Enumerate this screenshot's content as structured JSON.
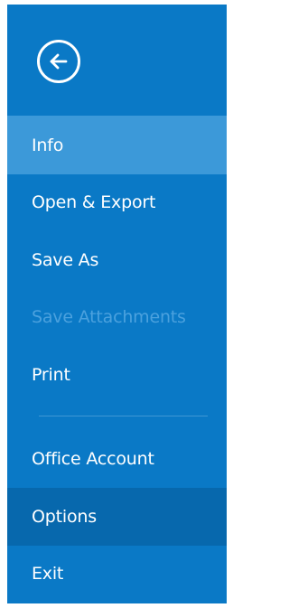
{
  "backstage": {
    "back_icon": "back-arrow-circle-icon",
    "items": [
      {
        "label": "Info",
        "state": "selected"
      },
      {
        "label": "Open & Export",
        "state": "normal"
      },
      {
        "label": "Save As",
        "state": "normal"
      },
      {
        "label": "Save Attachments",
        "state": "disabled"
      },
      {
        "label": "Print",
        "state": "normal"
      },
      {
        "label": "Office Account",
        "state": "normal"
      },
      {
        "label": "Options",
        "state": "hovered"
      },
      {
        "label": "Exit",
        "state": "normal"
      }
    ],
    "colors": {
      "background": "#0a79c6",
      "selected": "#3c99d9",
      "hovered": "#0768ad",
      "disabled_text": "#4ba1de",
      "text": "#ffffff"
    }
  }
}
